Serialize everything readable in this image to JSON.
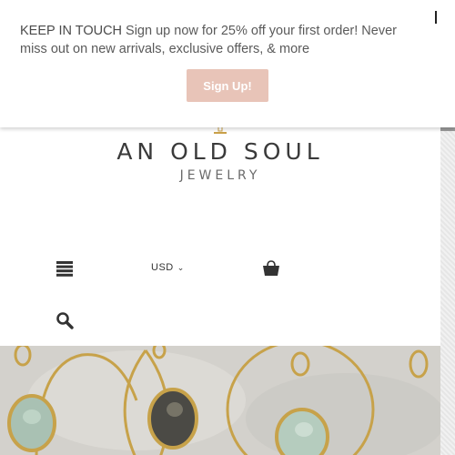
{
  "popup": {
    "lead": "KEEP IN TOUCH",
    "message": " Sign up now for 25% off your first order! Never miss out on new arrivals, exclusive offers, & more",
    "signup_label": "Sign Up!"
  },
  "header": {
    "logo_title": "AN OLD SOUL",
    "logo_subtitle": "JEWELRY"
  },
  "nav": {
    "currency": "USD",
    "currency_chevron": "⌄"
  },
  "icons": {
    "menu": "menu-icon",
    "cart": "cart-icon",
    "search": "search-icon",
    "close": "close-icon"
  },
  "colors": {
    "signup_button": "#e8c4b8",
    "logo_gold": "#c9a14a",
    "text_dark": "#3a3a3a"
  }
}
